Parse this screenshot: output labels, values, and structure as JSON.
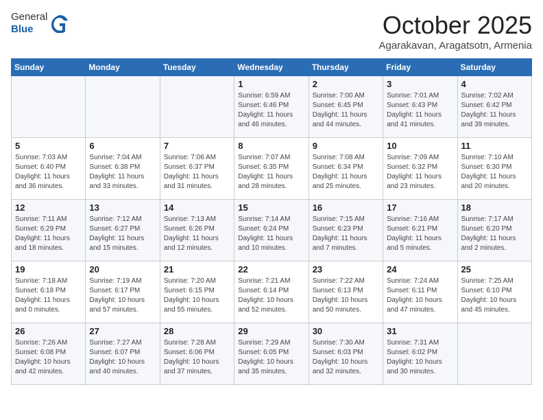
{
  "header": {
    "logo_general": "General",
    "logo_blue": "Blue",
    "month_title": "October 2025",
    "location": "Agarakavan, Aragatsotn, Armenia"
  },
  "weekdays": [
    "Sunday",
    "Monday",
    "Tuesday",
    "Wednesday",
    "Thursday",
    "Friday",
    "Saturday"
  ],
  "weeks": [
    [
      {
        "day": "",
        "info": ""
      },
      {
        "day": "",
        "info": ""
      },
      {
        "day": "",
        "info": ""
      },
      {
        "day": "1",
        "info": "Sunrise: 6:59 AM\nSunset: 6:46 PM\nDaylight: 11 hours\nand 46 minutes."
      },
      {
        "day": "2",
        "info": "Sunrise: 7:00 AM\nSunset: 6:45 PM\nDaylight: 11 hours\nand 44 minutes."
      },
      {
        "day": "3",
        "info": "Sunrise: 7:01 AM\nSunset: 6:43 PM\nDaylight: 11 hours\nand 41 minutes."
      },
      {
        "day": "4",
        "info": "Sunrise: 7:02 AM\nSunset: 6:42 PM\nDaylight: 11 hours\nand 39 minutes."
      }
    ],
    [
      {
        "day": "5",
        "info": "Sunrise: 7:03 AM\nSunset: 6:40 PM\nDaylight: 11 hours\nand 36 minutes."
      },
      {
        "day": "6",
        "info": "Sunrise: 7:04 AM\nSunset: 6:38 PM\nDaylight: 11 hours\nand 33 minutes."
      },
      {
        "day": "7",
        "info": "Sunrise: 7:06 AM\nSunset: 6:37 PM\nDaylight: 11 hours\nand 31 minutes."
      },
      {
        "day": "8",
        "info": "Sunrise: 7:07 AM\nSunset: 6:35 PM\nDaylight: 11 hours\nand 28 minutes."
      },
      {
        "day": "9",
        "info": "Sunrise: 7:08 AM\nSunset: 6:34 PM\nDaylight: 11 hours\nand 25 minutes."
      },
      {
        "day": "10",
        "info": "Sunrise: 7:09 AM\nSunset: 6:32 PM\nDaylight: 11 hours\nand 23 minutes."
      },
      {
        "day": "11",
        "info": "Sunrise: 7:10 AM\nSunset: 6:30 PM\nDaylight: 11 hours\nand 20 minutes."
      }
    ],
    [
      {
        "day": "12",
        "info": "Sunrise: 7:11 AM\nSunset: 6:29 PM\nDaylight: 11 hours\nand 18 minutes."
      },
      {
        "day": "13",
        "info": "Sunrise: 7:12 AM\nSunset: 6:27 PM\nDaylight: 11 hours\nand 15 minutes."
      },
      {
        "day": "14",
        "info": "Sunrise: 7:13 AM\nSunset: 6:26 PM\nDaylight: 11 hours\nand 12 minutes."
      },
      {
        "day": "15",
        "info": "Sunrise: 7:14 AM\nSunset: 6:24 PM\nDaylight: 11 hours\nand 10 minutes."
      },
      {
        "day": "16",
        "info": "Sunrise: 7:15 AM\nSunset: 6:23 PM\nDaylight: 11 hours\nand 7 minutes."
      },
      {
        "day": "17",
        "info": "Sunrise: 7:16 AM\nSunset: 6:21 PM\nDaylight: 11 hours\nand 5 minutes."
      },
      {
        "day": "18",
        "info": "Sunrise: 7:17 AM\nSunset: 6:20 PM\nDaylight: 11 hours\nand 2 minutes."
      }
    ],
    [
      {
        "day": "19",
        "info": "Sunrise: 7:18 AM\nSunset: 6:18 PM\nDaylight: 11 hours\nand 0 minutes."
      },
      {
        "day": "20",
        "info": "Sunrise: 7:19 AM\nSunset: 6:17 PM\nDaylight: 10 hours\nand 57 minutes."
      },
      {
        "day": "21",
        "info": "Sunrise: 7:20 AM\nSunset: 6:15 PM\nDaylight: 10 hours\nand 55 minutes."
      },
      {
        "day": "22",
        "info": "Sunrise: 7:21 AM\nSunset: 6:14 PM\nDaylight: 10 hours\nand 52 minutes."
      },
      {
        "day": "23",
        "info": "Sunrise: 7:22 AM\nSunset: 6:13 PM\nDaylight: 10 hours\nand 50 minutes."
      },
      {
        "day": "24",
        "info": "Sunrise: 7:24 AM\nSunset: 6:11 PM\nDaylight: 10 hours\nand 47 minutes."
      },
      {
        "day": "25",
        "info": "Sunrise: 7:25 AM\nSunset: 6:10 PM\nDaylight: 10 hours\nand 45 minutes."
      }
    ],
    [
      {
        "day": "26",
        "info": "Sunrise: 7:26 AM\nSunset: 6:08 PM\nDaylight: 10 hours\nand 42 minutes."
      },
      {
        "day": "27",
        "info": "Sunrise: 7:27 AM\nSunset: 6:07 PM\nDaylight: 10 hours\nand 40 minutes."
      },
      {
        "day": "28",
        "info": "Sunrise: 7:28 AM\nSunset: 6:06 PM\nDaylight: 10 hours\nand 37 minutes."
      },
      {
        "day": "29",
        "info": "Sunrise: 7:29 AM\nSunset: 6:05 PM\nDaylight: 10 hours\nand 35 minutes."
      },
      {
        "day": "30",
        "info": "Sunrise: 7:30 AM\nSunset: 6:03 PM\nDaylight: 10 hours\nand 32 minutes."
      },
      {
        "day": "31",
        "info": "Sunrise: 7:31 AM\nSunset: 6:02 PM\nDaylight: 10 hours\nand 30 minutes."
      },
      {
        "day": "",
        "info": ""
      }
    ]
  ]
}
